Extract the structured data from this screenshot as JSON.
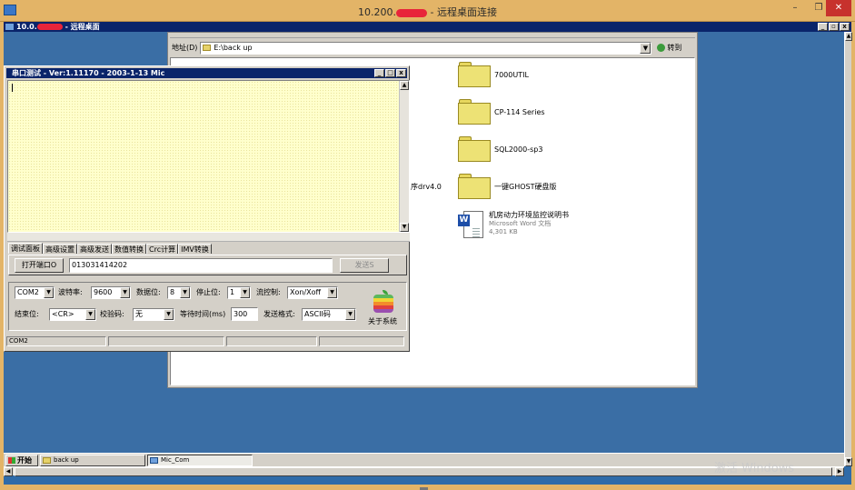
{
  "rdp_window": {
    "title_prefix": "10.200.",
    "title_suffix": " - 远程桌面连接",
    "controls": {
      "minimize": "–",
      "maximize": "❐",
      "close": "✕"
    }
  },
  "remote_window": {
    "title_prefix": "10.0.",
    "title_suffix": " - 远程桌面"
  },
  "explorer": {
    "address_label": "地址(D)",
    "address_value": "E:\\back up",
    "go_label": "转到",
    "items": [
      {
        "name": "7000UTIL",
        "icon": "folder-icon"
      },
      {
        "name": "CP-114 Series",
        "icon": "folder-icon"
      },
      {
        "name": "SQL2000-sp3",
        "icon": "folder-icon"
      },
      {
        "name": "一键GHOST硬盘版",
        "icon": "folder-icon"
      }
    ],
    "partial_label": "序drv4.0",
    "document": {
      "name": "机房动力环境监控说明书",
      "type": "Microsoft Word 文档",
      "size": "4,301 KB",
      "icon": "word-document-icon"
    }
  },
  "serial_tool": {
    "title": "串口测试 - Ver:1.11170 - 2003-1-13 Mic",
    "tabs": [
      "调试面板",
      "高级设置",
      "高级发送",
      "数值转换",
      "Crc计算",
      "IMV转换"
    ],
    "open_port_label": "打开端口O",
    "send_text": "013031414202",
    "send_label": "发送S",
    "port": {
      "label": "",
      "value": "COM2"
    },
    "baud": {
      "label": "波特率:",
      "value": "9600"
    },
    "databits": {
      "label": "数据位:",
      "value": "8"
    },
    "stopbits": {
      "label": "停止位:",
      "value": "1"
    },
    "flow": {
      "label": "流控制:",
      "value": "Xon/Xoff"
    },
    "endbit": {
      "label": "结束位:",
      "value": "<CR>"
    },
    "parity": {
      "label": "校验码:",
      "value": "无"
    },
    "wait": {
      "label": "等待时间(ms)",
      "value": "300"
    },
    "send_format": {
      "label": "发送格式:",
      "value": "ASCII码"
    },
    "about_label": "关于系统",
    "status_port": "COM2"
  },
  "taskbar": {
    "start_label": "开始",
    "tasks": [
      {
        "label": "back up",
        "active": false
      },
      {
        "label": "Mic_Com",
        "active": true
      }
    ]
  },
  "watermark": "激活 Windows"
}
